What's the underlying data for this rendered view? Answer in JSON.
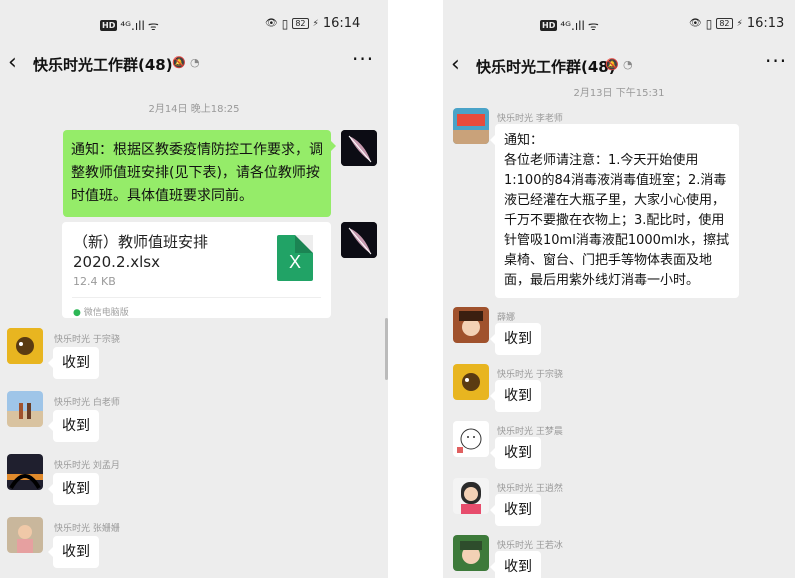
{
  "left": {
    "status": {
      "network": "HD",
      "signal": "⁴ᴳ.ıll",
      "wifi": "ᯤ",
      "eye": "👁",
      "vibrate": "▯",
      "battery": "82",
      "leaf": "⚡",
      "time": "16:14"
    },
    "nav": {
      "back": "‹",
      "title": "快乐时光工作群(48)",
      "mute_icon": "🔕",
      "ear_icon": "◔",
      "more": "···"
    },
    "timestamp": "2月14日 晚上18:25",
    "own_message": "通知：根据区教委疫情防控工作要求，调整教师值班安排(见下表)，请各位教师按时值班。具体值班要求同前。",
    "file": {
      "name": "（新）教师值班安排 2020.2.xlsx",
      "size": "12.4 KB",
      "icon_letter": "X",
      "source": "微信电脑版"
    },
    "messages": [
      {
        "sender": "快乐时光 于宗骁",
        "text": "收到"
      },
      {
        "sender": "快乐时光 白老师",
        "text": "收到"
      },
      {
        "sender": "快乐时光 刘孟月",
        "text": "收到"
      },
      {
        "sender": "快乐时光 张姗姗",
        "text": "收到"
      }
    ]
  },
  "right": {
    "status": {
      "network": "HD",
      "signal": "⁴ᴳ.ıll",
      "wifi": "ᯤ",
      "eye": "👁",
      "vibrate": "▯",
      "battery": "82",
      "leaf": "⚡",
      "time": "16:13"
    },
    "nav": {
      "back": "‹",
      "title": "快乐时光工作群(48)",
      "mute_icon": "🔕",
      "ear_icon": "◔",
      "more": "···"
    },
    "timestamp": "2月13日 下午15:31",
    "notice": {
      "sender": "快乐时光 李老师",
      "line1": "通知：",
      "body": "各位老师请注意：1.今天开始使用1:100的84消毒液消毒值班室；2.消毒液已经灌在大瓶子里，大家小心使用，千万不要撒在衣物上；3.配比时，使用针管吸10ml消毒液配1000ml水，擦拭桌椅、窗台、门把手等物体表面及地面，最后用紫外线灯消毒一小时。"
    },
    "messages": [
      {
        "sender": "薛娜",
        "text": "收到"
      },
      {
        "sender": "快乐时光 于宗骁",
        "text": "收到"
      },
      {
        "sender": "快乐时光 王梦晨",
        "text": "收到"
      },
      {
        "sender": "快乐时光 王逍然",
        "text": "收到"
      },
      {
        "sender": "快乐时光 王若冰",
        "text": "收到"
      }
    ]
  },
  "colors": {
    "green_bubble": "#95ec69",
    "chat_bg": "#ededed",
    "excel": "#21a366"
  }
}
